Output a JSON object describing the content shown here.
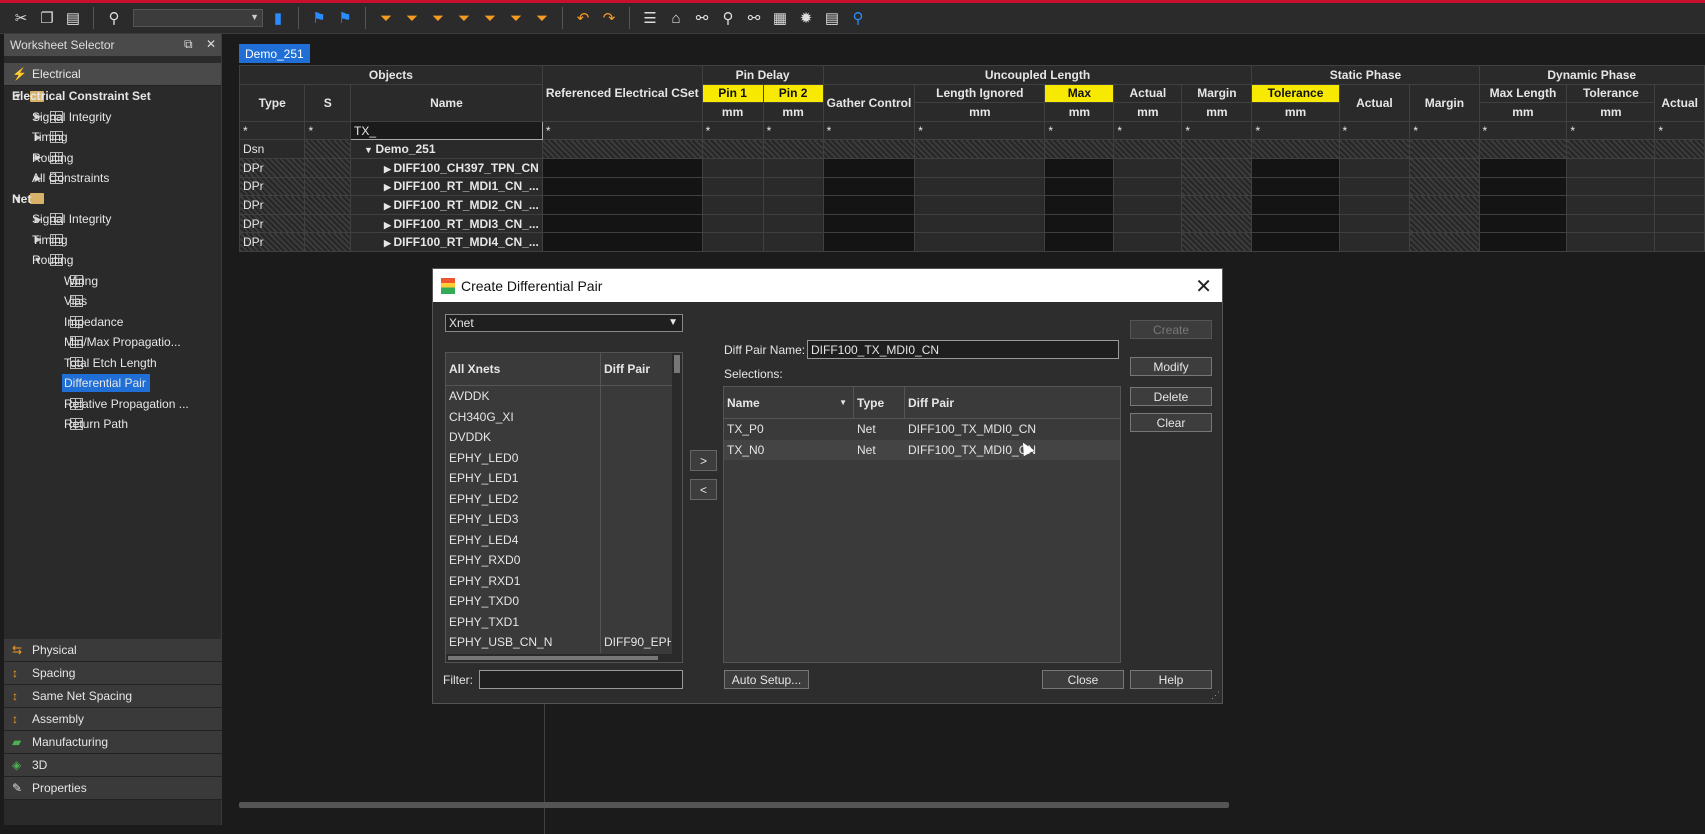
{
  "worksheet_selector": {
    "title": "Worksheet Selector",
    "top_category": "Electrical",
    "tree": [
      {
        "label": "Electrical Constraint Set",
        "level": 0,
        "kind": "folder",
        "expanded": true,
        "bold": true
      },
      {
        "label": "Signal Integrity",
        "level": 1,
        "kind": "sheet",
        "expanded": false
      },
      {
        "label": "Timing",
        "level": 1,
        "kind": "sheet",
        "expanded": false
      },
      {
        "label": "Routing",
        "level": 1,
        "kind": "sheet",
        "expanded": false
      },
      {
        "label": "All Constraints",
        "level": 1,
        "kind": "sheet",
        "expanded": false
      },
      {
        "label": "Net",
        "level": 0,
        "kind": "folder",
        "expanded": true,
        "bold": true
      },
      {
        "label": "Signal Integrity",
        "level": 1,
        "kind": "sheet",
        "expanded": false
      },
      {
        "label": "Timing",
        "level": 1,
        "kind": "sheet",
        "expanded": false
      },
      {
        "label": "Routing",
        "level": 1,
        "kind": "sheet",
        "expanded": true
      },
      {
        "label": "Wiring",
        "level": 2,
        "kind": "sheet"
      },
      {
        "label": "Vias",
        "level": 2,
        "kind": "sheet"
      },
      {
        "label": "Impedance",
        "level": 2,
        "kind": "sheet"
      },
      {
        "label": "Min/Max Propagatio...",
        "level": 2,
        "kind": "sheet"
      },
      {
        "label": "Total Etch Length",
        "level": 2,
        "kind": "sheet"
      },
      {
        "label": "Differential Pair",
        "level": 2,
        "kind": "sheet",
        "selected": true
      },
      {
        "label": "Relative Propagation ...",
        "level": 2,
        "kind": "sheet"
      },
      {
        "label": "Return Path",
        "level": 2,
        "kind": "sheet"
      }
    ],
    "bottom_categories": [
      "Physical",
      "Spacing",
      "Same Net Spacing",
      "Assembly",
      "Manufacturing",
      "3D",
      "Properties"
    ]
  },
  "document_tab": "Demo_251",
  "grid": {
    "group_headers": [
      "Objects",
      "Referenced Electrical CSet",
      "Pin Delay",
      "Uncoupled Length",
      "Static Phase",
      "Dynamic Phase"
    ],
    "columns": {
      "type": "Type",
      "s": "S",
      "name": "Name",
      "pin1": "Pin 1",
      "pin2": "Pin 2",
      "gather": "Gather Control",
      "length_ignored": "Length Ignored",
      "max": "Max",
      "actual": "Actual",
      "margin": "Margin",
      "tolerance": "Tolerance",
      "max_length": "Max Length"
    },
    "unit": "mm",
    "filter_star": "*",
    "name_filter": "TX_",
    "rows": [
      {
        "type": "Dsn",
        "name": "Demo_251"
      },
      {
        "type": "DPr",
        "name": "DIFF100_CH397_TPN_CN"
      },
      {
        "type": "DPr",
        "name": "DIFF100_RT_MDI1_CN_..."
      },
      {
        "type": "DPr",
        "name": "DIFF100_RT_MDI2_CN_..."
      },
      {
        "type": "DPr",
        "name": "DIFF100_RT_MDI3_CN_..."
      },
      {
        "type": "DPr",
        "name": "DIFF100_RT_MDI4_CN_..."
      }
    ]
  },
  "dialog": {
    "title": "Create Differential Pair",
    "type_select": "Xnet",
    "list_headers": {
      "col1": "All Xnets",
      "col2": "Diff Pair"
    },
    "xnets": [
      {
        "name": "AVDDK",
        "pair": ""
      },
      {
        "name": "CH340G_XI",
        "pair": ""
      },
      {
        "name": "DVDDK",
        "pair": ""
      },
      {
        "name": "EPHY_LED0",
        "pair": ""
      },
      {
        "name": "EPHY_LED1",
        "pair": ""
      },
      {
        "name": "EPHY_LED2",
        "pair": ""
      },
      {
        "name": "EPHY_LED3",
        "pair": ""
      },
      {
        "name": "EPHY_LED4",
        "pair": ""
      },
      {
        "name": "EPHY_RXD0",
        "pair": ""
      },
      {
        "name": "EPHY_RXD1",
        "pair": ""
      },
      {
        "name": "EPHY_TXD0",
        "pair": ""
      },
      {
        "name": "EPHY_TXD1",
        "pair": ""
      },
      {
        "name": "EPHY_USB_CN_N",
        "pair": "DIFF90_EPH..."
      }
    ],
    "move_right": ">",
    "move_left": "<",
    "diff_pair_name_label": "Diff Pair Name:",
    "diff_pair_name_value": "DIFF100_TX_MDI0_CN",
    "selections_label": "Selections:",
    "sel_headers": {
      "name": "Name",
      "type": "Type",
      "pair": "Diff Pair"
    },
    "selections": [
      {
        "name": "TX_P0",
        "type": "Net",
        "pair": "DIFF100_TX_MDI0_CN"
      },
      {
        "name": "TX_N0",
        "type": "Net",
        "pair": "DIFF100_TX_MDI0_CN"
      }
    ],
    "buttons": {
      "create": "Create",
      "modify": "Modify",
      "delete": "Delete",
      "clear": "Clear",
      "auto_setup": "Auto Setup...",
      "close": "Close",
      "help": "Help"
    },
    "filter_label": "Filter:"
  }
}
